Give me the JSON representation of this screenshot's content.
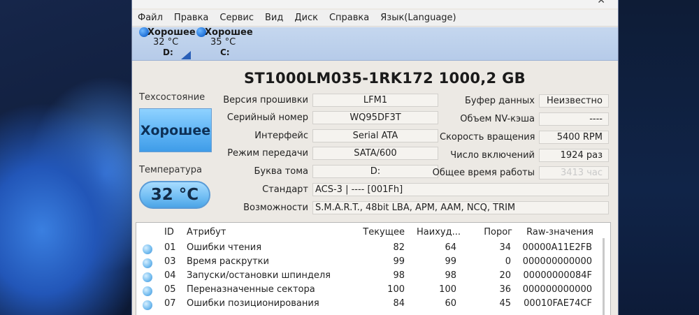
{
  "window": {
    "menu": [
      "Файл",
      "Правка",
      "Сервис",
      "Вид",
      "Диск",
      "Справка",
      "Язык(Language)"
    ]
  },
  "drives": [
    {
      "status": "Хорошее",
      "temperature": "32 °C",
      "letter": "D:"
    },
    {
      "status": "Хорошее",
      "temperature": "35 °C",
      "letter": "C:"
    }
  ],
  "disk": {
    "model": "ST1000LM035-1RK172 1000,2 GB",
    "health_label": "Техсостояние",
    "health_value": "Хорошее",
    "temperature_label": "Температура",
    "temperature_value": "32 °C"
  },
  "info_left": [
    {
      "label": "Версия прошивки",
      "value": "LFM1"
    },
    {
      "label": "Серийный номер",
      "value": "WQ95DF3T"
    },
    {
      "label": "Интерфейс",
      "value": "Serial ATA"
    },
    {
      "label": "Режим передачи",
      "value": "SATA/600"
    },
    {
      "label": "Буква тома",
      "value": "D:"
    }
  ],
  "info_right": [
    {
      "label": "Буфер данных",
      "value": "Неизвестно"
    },
    {
      "label": "Объем NV-кэша",
      "value": "----"
    },
    {
      "label": "Скорость вращения",
      "value": "5400 RPM"
    },
    {
      "label": "Число включений",
      "value": "1924 раз"
    },
    {
      "label": "Общее время работы",
      "value": "3413 час"
    }
  ],
  "standard": {
    "label": "Стандарт",
    "value": "ACS-3 | ---- [001Fh]"
  },
  "features": {
    "label": "Возможности",
    "value": "S.M.A.R.T., 48bit LBA, APM, AAM, NCQ, TRIM"
  },
  "smart": {
    "headers": {
      "id": "ID",
      "attribute": "Атрибут",
      "current": "Текущее",
      "worst": "Наихуд...",
      "threshold": "Порог",
      "raw": "Raw-значения"
    },
    "rows": [
      {
        "id": "01",
        "attribute": "Ошибки чтения",
        "current": "82",
        "worst": "64",
        "threshold": "34",
        "raw": "00000A11E2FB"
      },
      {
        "id": "03",
        "attribute": "Время раскрутки",
        "current": "99",
        "worst": "99",
        "threshold": "0",
        "raw": "000000000000"
      },
      {
        "id": "04",
        "attribute": "Запуски/остановки шпинделя",
        "current": "98",
        "worst": "98",
        "threshold": "20",
        "raw": "00000000084F"
      },
      {
        "id": "05",
        "attribute": "Переназначенные сектора",
        "current": "100",
        "worst": "100",
        "threshold": "36",
        "raw": "000000000000"
      },
      {
        "id": "07",
        "attribute": "Ошибки позиционирования",
        "current": "84",
        "worst": "60",
        "threshold": "45",
        "raw": "00010FAE74CF"
      }
    ]
  },
  "colors": {
    "health_blue": "#5fb4f5",
    "drivebar": "#b6cbe9"
  }
}
